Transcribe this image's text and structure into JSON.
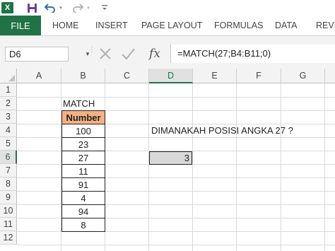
{
  "app": {
    "logo_text": "X"
  },
  "quick_access": {
    "save": "save-icon",
    "undo": "undo-icon",
    "redo": "redo-icon",
    "dropdown_glyph": "▾"
  },
  "ribbon": {
    "file": "FILE",
    "tabs": [
      "HOME",
      "INSERT",
      "PAGE LAYOUT",
      "FORMULAS",
      "DATA",
      "REVIE"
    ]
  },
  "formula_bar": {
    "name_box": "D6",
    "name_box_dropdown": "▼",
    "fx_label": "fx",
    "formula": "=MATCH(27;B4:B11;0)"
  },
  "sheet": {
    "columns": [
      "A",
      "B",
      "C",
      "D",
      "E",
      "F",
      "G"
    ],
    "active_column": "D",
    "rows": [
      "1",
      "2",
      "3",
      "4",
      "5",
      "6",
      "7",
      "8",
      "9",
      "10",
      "11",
      "12"
    ],
    "active_row": "6",
    "b2": "MATCH",
    "header": "Number",
    "header_fill": "#f4b183",
    "values": [
      "100",
      "23",
      "27",
      "11",
      "91",
      "4",
      "94",
      "8"
    ],
    "d4": "DIMANAKAH POSISI ANGKA 27 ?",
    "d6": "3",
    "selected_fill": "#d8d8d8"
  },
  "colors": {
    "accent": "#217346"
  }
}
